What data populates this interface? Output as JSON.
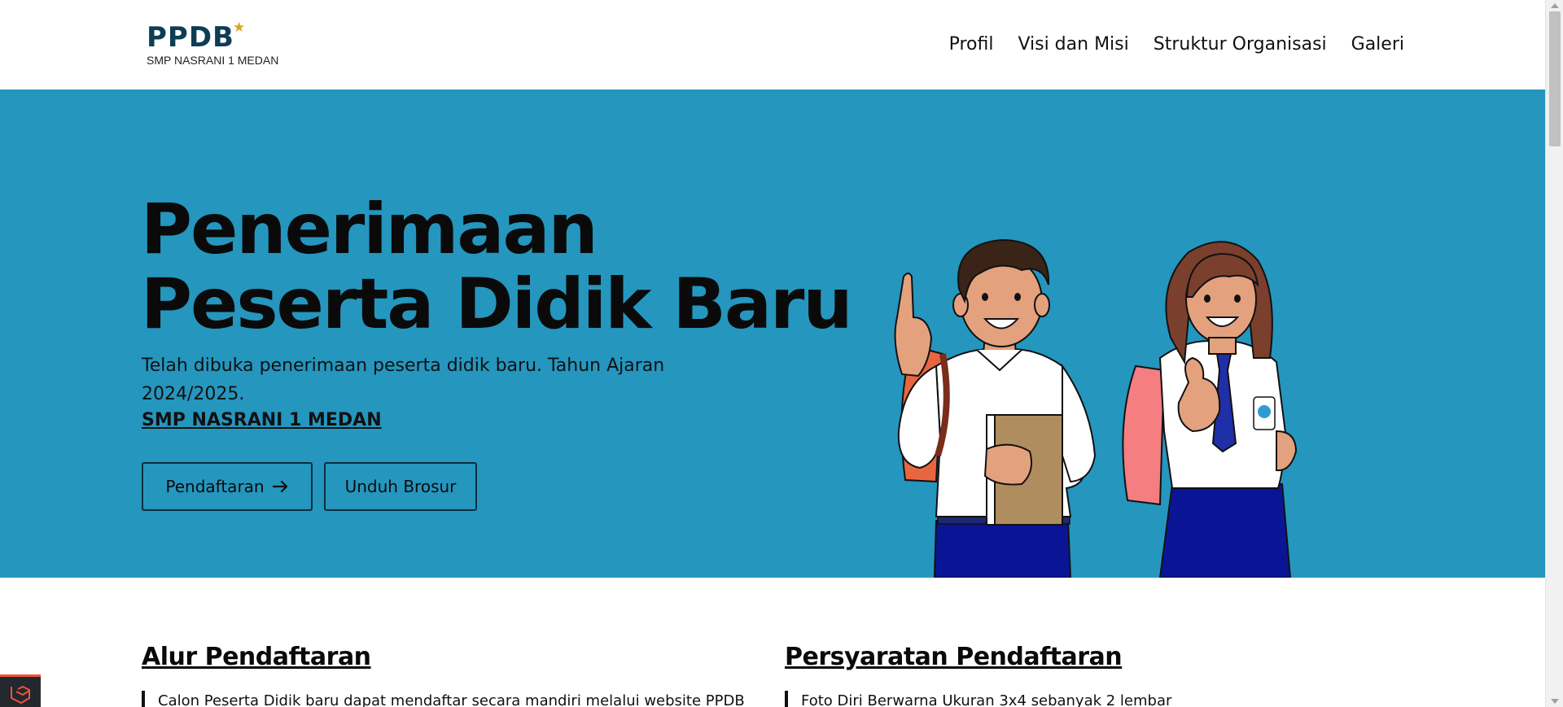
{
  "header": {
    "logo_text": "PPDB",
    "logo_subtitle": "SMP NASRANI 1 MEDAN",
    "nav": [
      {
        "label": "Profil"
      },
      {
        "label": "Visi dan Misi"
      },
      {
        "label": "Struktur Organisasi"
      },
      {
        "label": "Galeri"
      }
    ]
  },
  "hero": {
    "title_line1": "Penerimaan",
    "title_line2": "Peserta Didik Baru",
    "description": "Telah dibuka penerimaan peserta didik baru. Tahun Ajaran 2024/2025.",
    "school_link": "SMP NASRANI 1 MEDAN",
    "buttons": {
      "register_label": "Pendaftaran",
      "brochure_label": "Unduh Brosur"
    }
  },
  "sections": {
    "alur": {
      "title": "Alur Pendaftaran",
      "first_item": "Calon Peserta Didik baru dapat mendaftar secara mandiri melalui website PPDB"
    },
    "persyaratan": {
      "title": "Persyaratan Pendaftaran",
      "first_item": "Foto Diri Berwarna Ukuran 3x4 sebanyak 2 lembar"
    }
  },
  "colors": {
    "hero_background": "#2596be",
    "logo_navy": "#0e3d55",
    "logo_star": "#d9a521"
  },
  "icons": {
    "register_arrow": "arrow-right-icon",
    "debug_badge": "laravel-debugbar-icon",
    "logo_star": "star-icon"
  }
}
